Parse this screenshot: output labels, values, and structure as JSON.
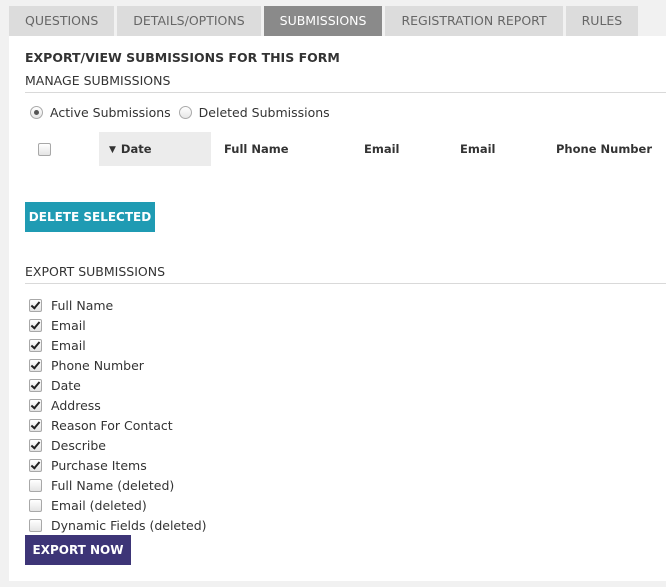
{
  "tabs": [
    {
      "label": "QUESTIONS"
    },
    {
      "label": "DETAILS/OPTIONS"
    },
    {
      "label": "SUBMISSIONS"
    },
    {
      "label": "REGISTRATION REPORT"
    },
    {
      "label": "RULES"
    }
  ],
  "active_tab": "SUBMISSIONS",
  "heading": "EXPORT/VIEW SUBMISSIONS FOR THIS FORM",
  "manage": {
    "title": "MANAGE SUBMISSIONS",
    "radio_active": "Active Submissions",
    "radio_deleted": "Deleted Submissions",
    "selected": "Active Submissions"
  },
  "table": {
    "columns": [
      "Date",
      "Full Name",
      "Email",
      "Email",
      "Phone Number"
    ],
    "sorted_column": "Date",
    "sort_direction": "descending"
  },
  "delete_button": "DELETE SELECTED",
  "export": {
    "title": "EXPORT SUBMISSIONS",
    "fields": [
      {
        "label": "Full Name",
        "checked": true
      },
      {
        "label": "Email",
        "checked": true
      },
      {
        "label": "Email",
        "checked": true
      },
      {
        "label": "Phone Number",
        "checked": true
      },
      {
        "label": "Date",
        "checked": true
      },
      {
        "label": "Address",
        "checked": true
      },
      {
        "label": "Reason For Contact",
        "checked": true
      },
      {
        "label": "Describe",
        "checked": true
      },
      {
        "label": "Purchase Items",
        "checked": true
      },
      {
        "label": "Full Name (deleted)",
        "checked": false
      },
      {
        "label": "Email (deleted)",
        "checked": false
      },
      {
        "label": "Dynamic Fields (deleted)",
        "checked": false
      }
    ],
    "button": "EXPORT NOW"
  },
  "colors": {
    "delete_button": "#1f9bb3",
    "export_button": "#3d3577",
    "active_tab": "#8a8a8a"
  }
}
